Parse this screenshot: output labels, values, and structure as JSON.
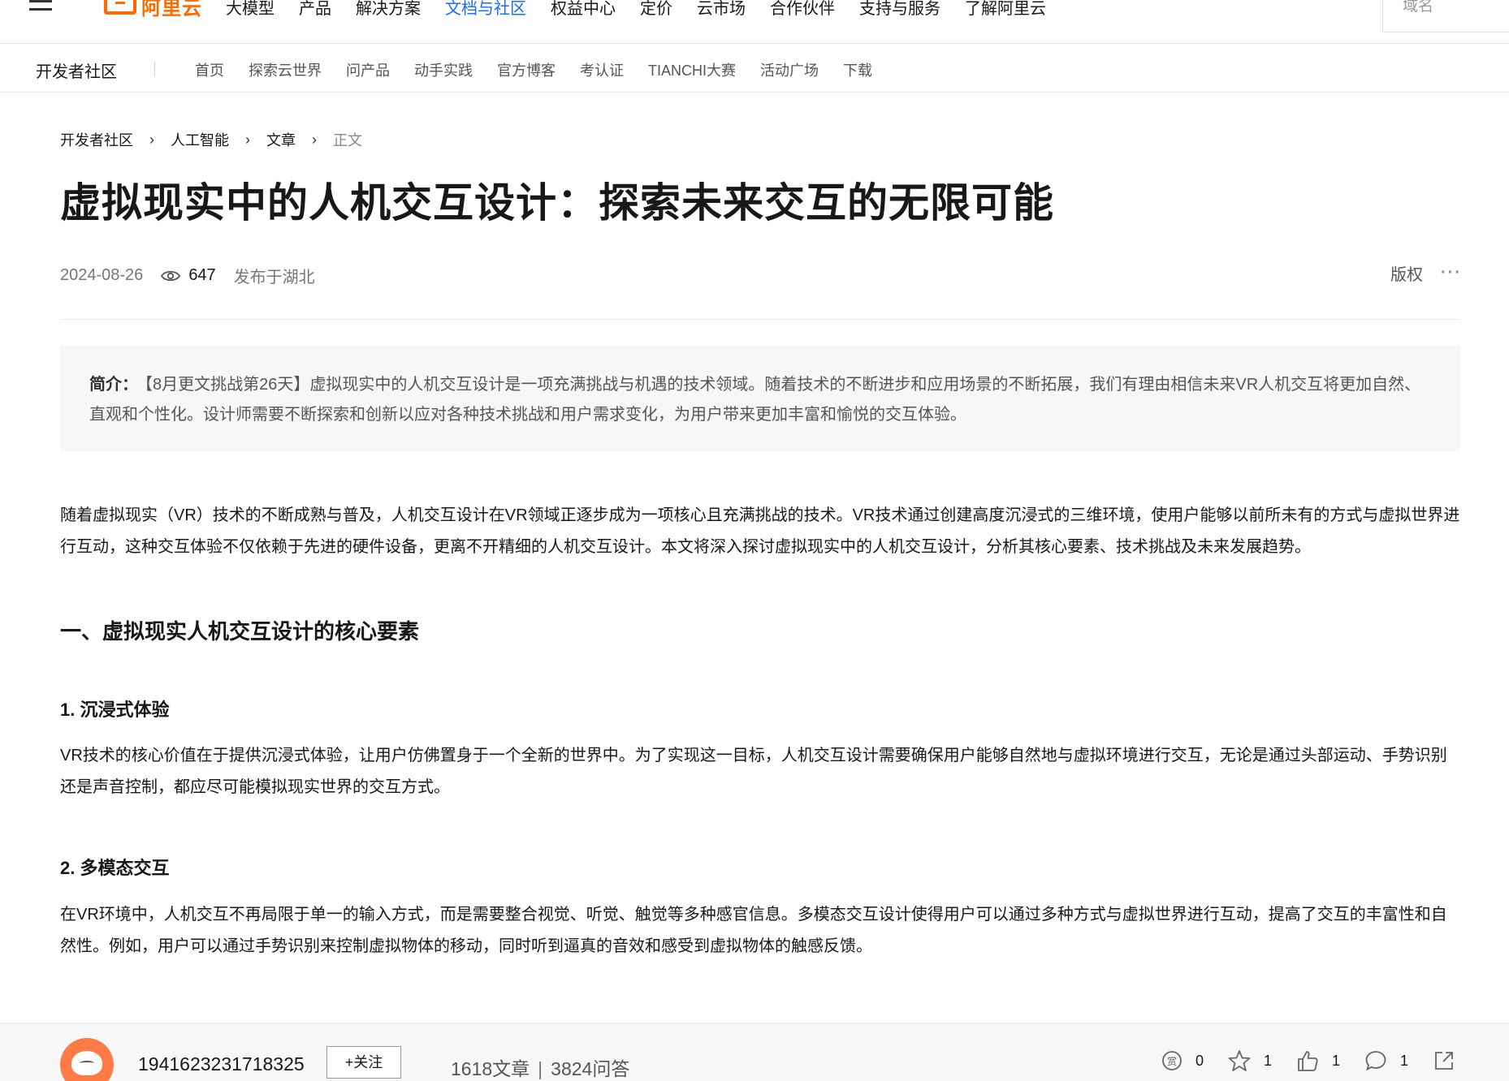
{
  "topnav": {
    "logo_text": "阿里云",
    "menu": [
      "大模型",
      "产品",
      "解决方案",
      "文档与社区",
      "权益中心",
      "定价",
      "云市场",
      "合作伙伴",
      "支持与服务",
      "了解阿里云"
    ],
    "search_placeholder": "域名"
  },
  "subnav": {
    "title": "开发者社区",
    "menu": [
      "首页",
      "探索云世界",
      "问产品",
      "动手实践",
      "官方博客",
      "考认证",
      "TIANCHI大赛",
      "活动广场",
      "下载"
    ]
  },
  "breadcrumb": [
    "开发者社区",
    "人工智能",
    "文章",
    "正文"
  ],
  "article": {
    "title": "虚拟现实中的人机交互设计：探索未来交互的无限可能",
    "date": "2024-08-26",
    "views": "647",
    "location": "发布于湖北",
    "copyright": "版权",
    "more": "···",
    "summary_label": "简介：",
    "summary_text": "【8月更文挑战第26天】虚拟现实中的人机交互设计是一项充满挑战与机遇的技术领域。随着技术的不断进步和应用场景的不断拓展，我们有理由相信未来VR人机交互将更加自然、直观和个性化。设计师需要不断探索和创新以应对各种技术挑战和用户需求变化，为用户带来更加丰富和愉悦的交互体验。",
    "intro": "随着虚拟现实（VR）技术的不断成熟与普及，人机交互设计在VR领域正逐步成为一项核心且充满挑战的技术。VR技术通过创建高度沉浸式的三维环境，使用户能够以前所未有的方式与虚拟世界进行互动，这种交互体验不仅依赖于先进的硬件设备，更离不开精细的人机交互设计。本文将深入探讨虚拟现实中的人机交互设计，分析其核心要素、技术挑战及未来发展趋势。",
    "section1_title": "一、虚拟现实人机交互设计的核心要素",
    "sub1_title": "1. 沉浸式体验",
    "sub1_text": "VR技术的核心价值在于提供沉浸式体验，让用户仿佛置身于一个全新的世界中。为了实现这一目标，人机交互设计需要确保用户能够自然地与虚拟环境进行交互，无论是通过头部运动、手势识别还是声音控制，都应尽可能模拟现实世界的交互方式。",
    "sub2_title": "2. 多模态交互",
    "sub2_text": "在VR环境中，人机交互不再局限于单一的输入方式，而是需要整合视觉、听觉、触觉等多种感官信息。多模态交互设计使得用户可以通过多种方式与虚拟世界进行互动，提高了交互的丰富性和自然性。例如，用户可以通过手势识别来控制虚拟物体的移动，同时听到逼真的音效和感受到虚拟物体的触感反馈。"
  },
  "footer": {
    "username": "1941623231718325",
    "follow_label": "+关注",
    "articles": "1618文章",
    "answers": "3824问答",
    "reward_count": "0",
    "favorite_count": "1",
    "like_count": "1",
    "comment_count": "1"
  },
  "colors": {
    "brand": "#ff6a00",
    "active_link": "#1a6bff"
  }
}
